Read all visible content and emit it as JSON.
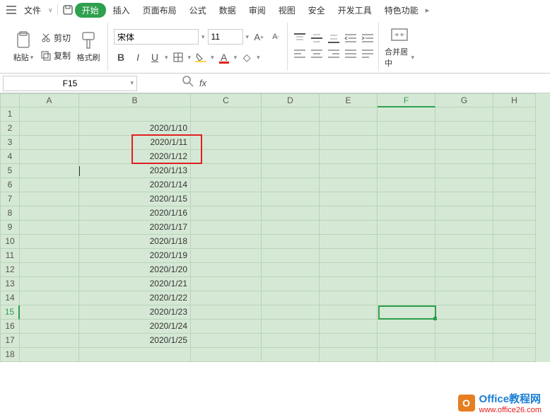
{
  "menu": {
    "file": "文件",
    "start": "开始",
    "insert": "插入",
    "page_layout": "页面布局",
    "formula": "公式",
    "data": "数据",
    "review": "审阅",
    "view": "视图",
    "security": "安全",
    "dev_tools": "开发工具",
    "special": "特色功能"
  },
  "toolbar": {
    "paste": "粘贴",
    "cut": "剪切",
    "copy": "复制",
    "format_painter": "格式刷",
    "font_name": "宋体",
    "font_size": "11",
    "merge_center": "合并居中"
  },
  "name_box": "F15",
  "fx": "fx",
  "columns": [
    "A",
    "B",
    "C",
    "D",
    "E",
    "F",
    "G",
    "H"
  ],
  "rows": [
    {
      "n": "1",
      "b": ""
    },
    {
      "n": "2",
      "b": "2020/1/10"
    },
    {
      "n": "3",
      "b": "2020/1/11"
    },
    {
      "n": "4",
      "b": "2020/1/12"
    },
    {
      "n": "5",
      "b": "2020/1/13"
    },
    {
      "n": "6",
      "b": "2020/1/14"
    },
    {
      "n": "7",
      "b": "2020/1/15"
    },
    {
      "n": "8",
      "b": "2020/1/16"
    },
    {
      "n": "9",
      "b": "2020/1/17"
    },
    {
      "n": "10",
      "b": "2020/1/18"
    },
    {
      "n": "11",
      "b": "2020/1/19"
    },
    {
      "n": "12",
      "b": "2020/1/20"
    },
    {
      "n": "13",
      "b": "2020/1/21"
    },
    {
      "n": "14",
      "b": "2020/1/22"
    },
    {
      "n": "15",
      "b": "2020/1/23"
    },
    {
      "n": "16",
      "b": "2020/1/24"
    },
    {
      "n": "17",
      "b": "2020/1/25"
    },
    {
      "n": "18",
      "b": ""
    }
  ],
  "active": {
    "col": "F",
    "row": "15"
  },
  "watermark": {
    "title": "Office教程网",
    "sub": "www.office26.com"
  }
}
